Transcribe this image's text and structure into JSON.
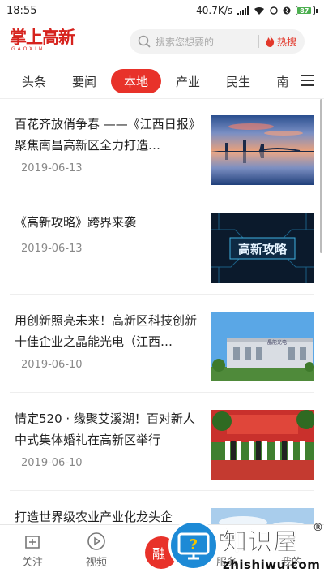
{
  "status_bar": {
    "time": "18:55",
    "net_speed": "40.7K/s",
    "battery": "87"
  },
  "header": {
    "logo_text": "掌上高新",
    "logo_sub": "GAOXIN",
    "search_placeholder": "搜索您想要的",
    "hot_search_label": "热搜"
  },
  "tabs": [
    {
      "label": "头条",
      "active": false
    },
    {
      "label": "要闻",
      "active": false
    },
    {
      "label": "本地",
      "active": true
    },
    {
      "label": "产业",
      "active": false
    },
    {
      "label": "民生",
      "active": false
    },
    {
      "label": "南",
      "active": false
    }
  ],
  "articles": [
    {
      "title": "百花齐放俏争春 ——《江西日报》聚焦南昌高新区全力打造…",
      "date": "2019-06-13",
      "thumb": "skyline-lake"
    },
    {
      "title": "《高新攻略》跨界来袭",
      "date": "2019-06-13",
      "thumb": "circuit-banner",
      "thumb_text": "高新攻略"
    },
    {
      "title": "用创新照亮未来！高新区科技创新十佳企业之晶能光电（江西…",
      "date": "2019-06-10",
      "thumb": "factory-building",
      "thumb_text": "晶能光电"
    },
    {
      "title": "情定520 · 缘聚艾溪湖！百对新人中式集体婚礼在高新区举行",
      "date": "2019-06-10",
      "thumb": "wedding-stage"
    },
    {
      "title": "打造世界级农业产业化龙头企",
      "date": "",
      "thumb": "blue-sky"
    }
  ],
  "bottom_nav": [
    {
      "label": "关注",
      "icon": "follow-icon"
    },
    {
      "label": "视频",
      "icon": "video-icon"
    },
    {
      "label": "融",
      "icon": "center-icon"
    },
    {
      "label": "服务",
      "icon": "service-icon"
    },
    {
      "label": "我的",
      "icon": "profile-icon"
    }
  ],
  "watermark": {
    "brand": "知识屋",
    "url": "zhishiwu.com",
    "reg": "®"
  },
  "colors": {
    "brand_red": "#e8322a",
    "watermark_blue": "#1d8ad6"
  }
}
